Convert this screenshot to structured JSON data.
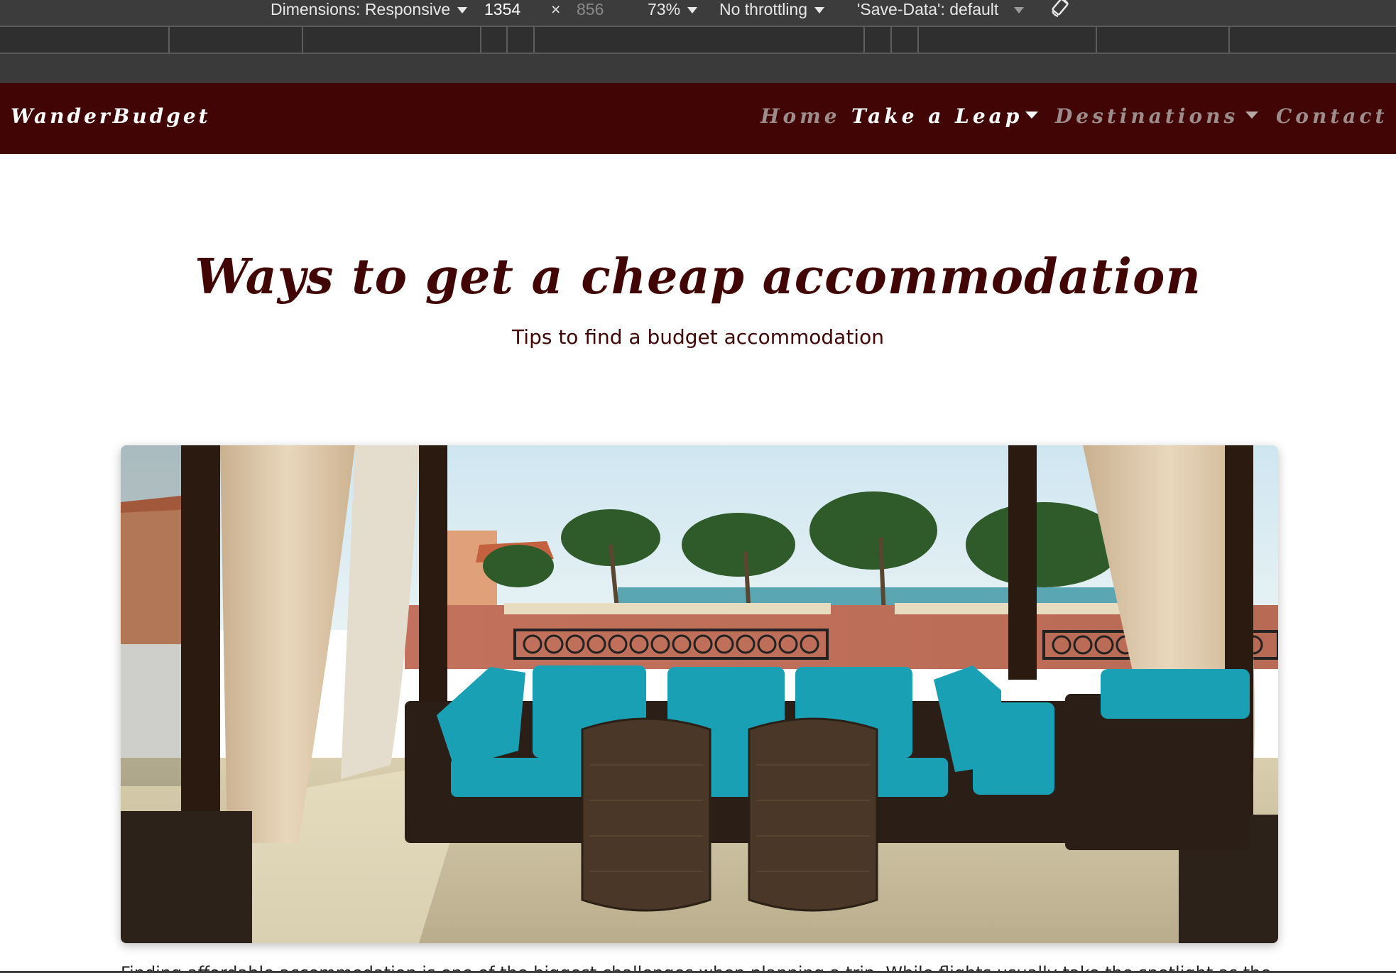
{
  "devtools": {
    "dimensions_label": "Dimensions: Responsive",
    "width_value": "1354",
    "times_symbol": "×",
    "height_value": "856",
    "zoom": "73%",
    "throttling": "No throttling",
    "save_data": "'Save-Data': default",
    "rotate_icon": "rotate-icon"
  },
  "site": {
    "brand": "WanderBudget",
    "nav": {
      "home": "Home",
      "take_a_leap": "Take a Leap",
      "destinations": "Destinations",
      "contact": "Contact"
    },
    "colors": {
      "primary": "#420505",
      "nav_inactive": "#9c8c8c",
      "nav_active": "#ffffff"
    }
  },
  "hero": {
    "title": "Ways to get a cheap accommodation",
    "subtitle": "Tips to find a budget accommodation"
  },
  "photo": {
    "description_icon": "terrace-photo"
  },
  "article": {
    "intro": "Finding affordable accommodation is one of the biggest challenges when planning a trip. While flights usually take the spotlight as the major"
  }
}
